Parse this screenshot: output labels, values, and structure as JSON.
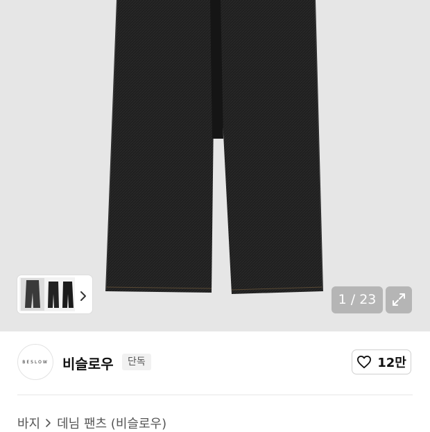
{
  "gallery": {
    "counter": "1 / 23"
  },
  "brand": {
    "logo_text": "BESLOW",
    "name": "비슬로우",
    "badge": "단독",
    "likes": "12만"
  },
  "breadcrumb": {
    "category": "바지",
    "product": "데님 팬츠 (비슬로우)"
  },
  "colors": {
    "hero_bg": "#e6e6e6",
    "denim": "#1e1e1e",
    "overlay": "#8c8c8c"
  }
}
